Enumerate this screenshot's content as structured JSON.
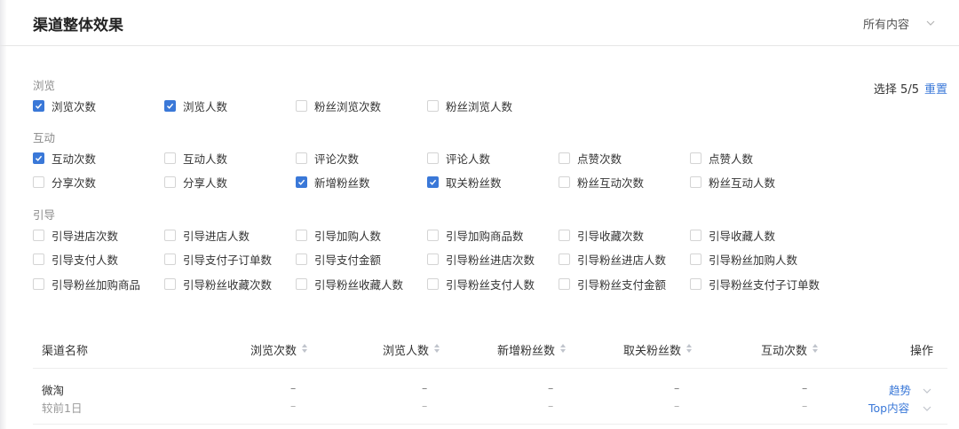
{
  "header": {
    "title": "渠道整体效果",
    "scope": "所有内容"
  },
  "selection": {
    "text": "选择 5/5",
    "reset": "重置"
  },
  "groups": [
    {
      "title": "浏览",
      "items": [
        {
          "label": "浏览次数",
          "checked": true
        },
        {
          "label": "浏览人数",
          "checked": true
        },
        {
          "label": "粉丝浏览次数",
          "checked": false
        },
        {
          "label": "粉丝浏览人数",
          "checked": false
        }
      ]
    },
    {
      "title": "互动",
      "items": [
        {
          "label": "互动次数",
          "checked": true
        },
        {
          "label": "互动人数",
          "checked": false
        },
        {
          "label": "评论次数",
          "checked": false
        },
        {
          "label": "评论人数",
          "checked": false
        },
        {
          "label": "点赞次数",
          "checked": false
        },
        {
          "label": "点赞人数",
          "checked": false
        },
        {
          "label": "分享次数",
          "checked": false
        },
        {
          "label": "分享人数",
          "checked": false
        },
        {
          "label": "新增粉丝数",
          "checked": true
        },
        {
          "label": "取关粉丝数",
          "checked": true
        },
        {
          "label": "粉丝互动次数",
          "checked": false
        },
        {
          "label": "粉丝互动人数",
          "checked": false
        }
      ]
    },
    {
      "title": "引导",
      "items": [
        {
          "label": "引导进店次数",
          "checked": false
        },
        {
          "label": "引导进店人数",
          "checked": false
        },
        {
          "label": "引导加购人数",
          "checked": false
        },
        {
          "label": "引导加购商品数",
          "checked": false
        },
        {
          "label": "引导收藏次数",
          "checked": false
        },
        {
          "label": "引导收藏人数",
          "checked": false
        },
        {
          "label": "引导支付人数",
          "checked": false
        },
        {
          "label": "引导支付子订单数",
          "checked": false
        },
        {
          "label": "引导支付金额",
          "checked": false
        },
        {
          "label": "引导粉丝进店次数",
          "checked": false
        },
        {
          "label": "引导粉丝进店人数",
          "checked": false
        },
        {
          "label": "引导粉丝加购人数",
          "checked": false
        },
        {
          "label": "引导粉丝加购商品",
          "checked": false
        },
        {
          "label": "引导粉丝收藏次数",
          "checked": false
        },
        {
          "label": "引导粉丝收藏人数",
          "checked": false
        },
        {
          "label": "引导粉丝支付人数",
          "checked": false
        },
        {
          "label": "引导粉丝支付金额",
          "checked": false
        },
        {
          "label": "引导粉丝支付子订单数",
          "checked": false
        }
      ]
    }
  ],
  "table": {
    "columns": [
      "渠道名称",
      "浏览次数",
      "浏览人数",
      "新增粉丝数",
      "取关粉丝数",
      "互动次数",
      "操作"
    ],
    "rows": [
      {
        "name": "微淘",
        "sub": "较前1日",
        "values": [
          "–",
          "–",
          "–",
          "–",
          "–"
        ],
        "compare": [
          "–",
          "–",
          "–",
          "–",
          "–"
        ],
        "actions": [
          "趋势",
          "Top内容"
        ]
      }
    ]
  },
  "colors": {
    "accent": "#3a78d8"
  }
}
